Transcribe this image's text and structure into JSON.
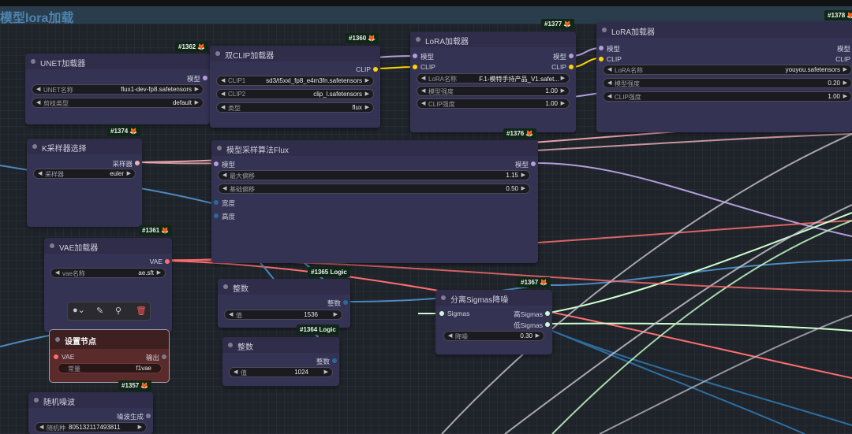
{
  "group": {
    "title": "模型lora加载"
  },
  "nodes": {
    "unet": {
      "badge": "#1362",
      "title": "UNET加载器",
      "output": "模型",
      "widgets": [
        {
          "name": "UNET名称",
          "value": "flux1-dev-fp8.safetensors"
        },
        {
          "name": "剪枝类型",
          "value": "default"
        }
      ]
    },
    "dualclip": {
      "badge": "#1360",
      "title": "双CLIP加载器",
      "output": "CLIP",
      "widgets": [
        {
          "name": "CLIP1",
          "value": "sd3/t5xxl_fp8_e4m3fn.safetensors"
        },
        {
          "name": "CLIP2",
          "value": "clip_l.safetensors"
        },
        {
          "name": "类型",
          "value": "flux"
        }
      ]
    },
    "lora1": {
      "badge": "#1377",
      "title": "LoRA加载器",
      "inputs": [
        "模型",
        "CLIP"
      ],
      "outputs": [
        "模型",
        "CLIP"
      ],
      "widgets": [
        {
          "name": "LoRA名称",
          "value": "F.1-模特手持产品_V1.safet..."
        },
        {
          "name": "模型强度",
          "value": "1.00"
        },
        {
          "name": "CLIP强度",
          "value": "1.00"
        }
      ]
    },
    "lora2": {
      "badge": "#1378",
      "title": "LoRA加载器",
      "inputs": [
        "模型",
        "CLIP"
      ],
      "outputs": [
        "模型",
        "CLIP"
      ],
      "widgets": [
        {
          "name": "LoRA名称",
          "value": "youyou.safetensors"
        },
        {
          "name": "模型强度",
          "value": "0.20"
        },
        {
          "name": "CLIP强度",
          "value": "1.00"
        }
      ]
    },
    "ksampler": {
      "badge": "#1374",
      "title": "K采样器选择",
      "output": "采样器",
      "widgets": [
        {
          "name": "采样器",
          "value": "euler"
        }
      ]
    },
    "modelsampling": {
      "badge": "#1376",
      "title": "模型采样算法Flux",
      "input": "模型",
      "output": "模型",
      "widgets": [
        {
          "name": "最大偏移",
          "value": "1.15"
        },
        {
          "name": "基础偏移",
          "value": "0.50"
        }
      ],
      "extra_inputs": [
        "宽度",
        "高度"
      ]
    },
    "vae": {
      "badge": "#1361",
      "title": "VAE加载器",
      "output": "VAE",
      "widgets": [
        {
          "name": "vae名称",
          "value": "ae.sft"
        }
      ]
    },
    "int1": {
      "badge": "#1365 Logic",
      "title": "整数",
      "output": "整数",
      "widgets": [
        {
          "name": "值",
          "value": "1536"
        }
      ]
    },
    "int2": {
      "badge": "#1364 Logic",
      "title": "整数",
      "output": "整数",
      "widgets": [
        {
          "name": "值",
          "value": "1024"
        }
      ]
    },
    "split": {
      "badge": "#1367",
      "title": "分离Sigmas降噪",
      "input": "Sigmas",
      "outputs": [
        "高Sigmas",
        "低Sigmas"
      ],
      "widgets": [
        {
          "name": "降噪",
          "value": "0.30"
        }
      ]
    },
    "setnode": {
      "title": "设置节点",
      "input": "VAE",
      "output": "输出",
      "widgets": [
        {
          "name": "常量",
          "value": "f1vae"
        }
      ]
    },
    "noise": {
      "badge": "#1357",
      "title": "随机噪波",
      "output": "噪波生成",
      "widgets": [
        {
          "name": "随机种",
          "value": "805132117493811"
        }
      ]
    }
  },
  "toolbox": {
    "icons": [
      "color-icon",
      "pin-icon",
      "bypass-icon",
      "delete-icon"
    ]
  },
  "colors": {
    "model": "#b39ddb",
    "clip": "#ffd500",
    "vae": "#ff6e6e",
    "int": "#29699c",
    "sigmas": "#cdffcd",
    "badge_fox": "#f07a28"
  }
}
